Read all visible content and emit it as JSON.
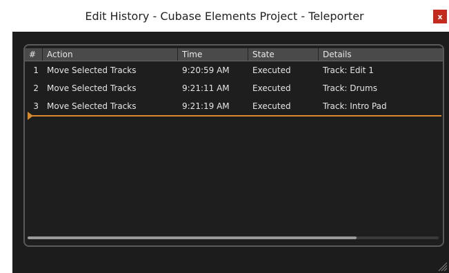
{
  "window": {
    "title": "Edit History - Cubase Elements Project - Teleporter",
    "close_label": "x"
  },
  "table": {
    "columns": [
      "#",
      "Action",
      "Time",
      "State",
      "Details"
    ],
    "rows": [
      {
        "num": "1",
        "action": "Move Selected Tracks",
        "time": "9:20:59 AM",
        "state": "Executed",
        "details": "Track: Edit 1"
      },
      {
        "num": "2",
        "action": "Move Selected Tracks",
        "time": "9:21:11 AM",
        "state": "Executed",
        "details": "Track: Drums"
      },
      {
        "num": "3",
        "action": "Move Selected Tracks",
        "time": "9:21:19 AM",
        "state": "Executed",
        "details": "Track: Intro Pad"
      }
    ]
  },
  "scrollbar": {
    "visible_fraction": 0.8
  },
  "colors": {
    "accent": "#d98a2b",
    "background": "#1c1c1c",
    "header": "#4a4a4a",
    "close": "#c42b1c"
  }
}
